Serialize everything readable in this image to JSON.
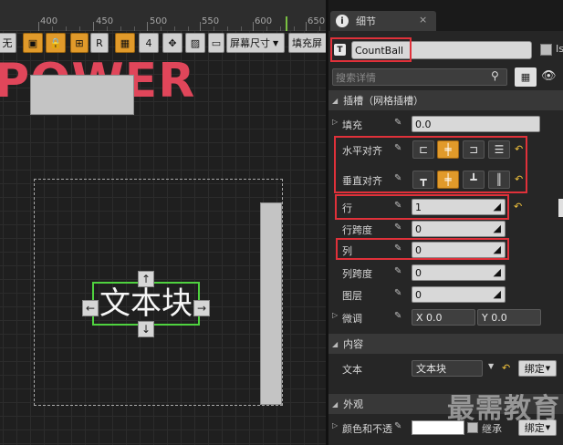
{
  "ruler": {
    "ticks": [
      "400",
      "450",
      "500",
      "550",
      "600",
      "650"
    ]
  },
  "toolbar": {
    "none_label": "无",
    "r_label": "R",
    "snap_value": "4",
    "screen_size_label": "屏幕尺寸",
    "fill_label": "填充屏"
  },
  "canvas": {
    "title_text": "POWER",
    "text_block": "文本块",
    "handles": {
      "up": "↑",
      "down": "↓",
      "left": "←",
      "right": "→"
    }
  },
  "details": {
    "tab_title": "细节",
    "tab_close": "×",
    "widget_type_icon": "T",
    "widget_name": "CountBall",
    "is_variable_label": "Is",
    "search_placeholder": "搜索详情",
    "slot_category": "插槽（网格插槽）",
    "padding": {
      "label": "填充",
      "value": "0.0"
    },
    "horizontal_alignment": {
      "label": "水平对齐"
    },
    "vertical_alignment": {
      "label": "垂直对齐"
    },
    "row": {
      "label": "行",
      "value": "1"
    },
    "row_span": {
      "label": "行跨度",
      "value": "0"
    },
    "column": {
      "label": "列",
      "value": "0"
    },
    "column_span": {
      "label": "列跨度",
      "value": "0"
    },
    "layer": {
      "label": "图层",
      "value": "0"
    },
    "nudge": {
      "label": "微调",
      "x_value": "X 0.0",
      "y_value": "Y 0.0"
    },
    "content_category": "内容",
    "text": {
      "label": "文本",
      "value": "文本块",
      "bind_label": "绑定"
    },
    "appearance_category": "外观",
    "color_opacity": {
      "label": "颜色和不透",
      "inherit_label": "继承",
      "bind_label": "绑定"
    }
  },
  "watermark": "最需教育",
  "colors": {
    "accent": "#e19a2a",
    "highlight_red": "#e0313a",
    "selection_green": "#4fd23f",
    "power_red": "#e0465a"
  }
}
